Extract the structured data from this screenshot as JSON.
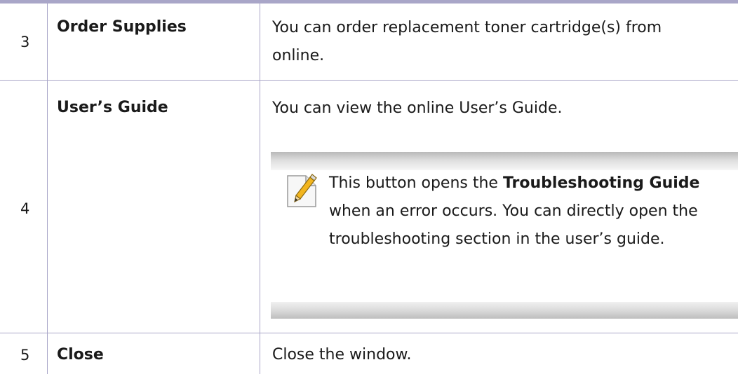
{
  "rows": [
    {
      "number": "3",
      "name": "Order Supplies",
      "description": "You can order replacement toner cartridge(s) from online."
    },
    {
      "number": "4",
      "name": "User’s Guide",
      "description": "You can view the online User’s Guide.",
      "note": {
        "icon": "note-pencil-icon",
        "text_before": "This button opens the ",
        "bold_text": "Troubleshooting Guide",
        "text_after": " when an error occurs. You can directly open the troubleshooting section in the user’s guide."
      }
    },
    {
      "number": "5",
      "name": "Close",
      "description": "Close the window."
    }
  ],
  "colors": {
    "rule": "#a9a6c8",
    "note_band": "#c8c8c8"
  }
}
